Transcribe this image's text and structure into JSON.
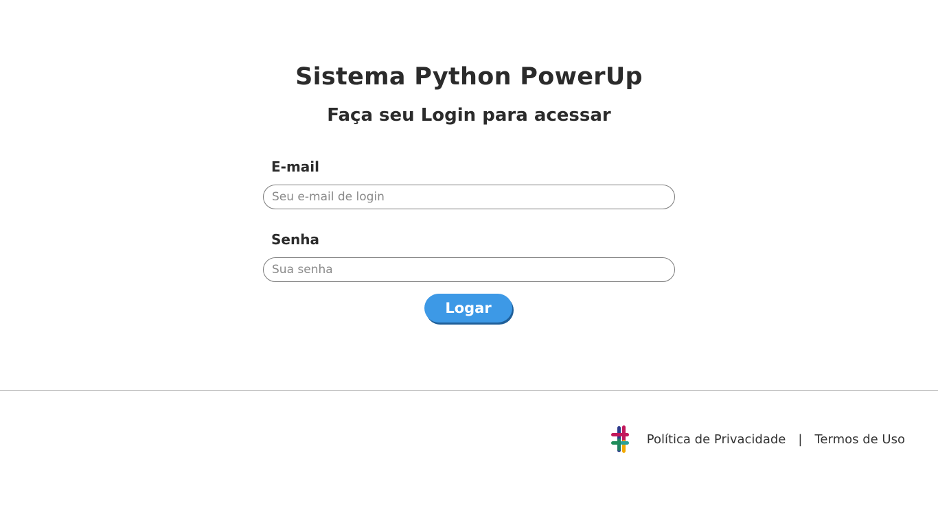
{
  "page": {
    "title": "Sistema Python PowerUp",
    "subtitle": "Faça seu Login para acessar"
  },
  "form": {
    "email_label": "E-mail",
    "email_placeholder": "Seu e-mail de login",
    "email_value": "",
    "password_label": "Senha",
    "password_placeholder": "Sua senha",
    "password_value": "",
    "submit_label": "Logar"
  },
  "footer": {
    "logo_icon": "hashtag-logo-icon",
    "privacy_link": "Política de Privacidade",
    "separator": "|",
    "terms_link": "Termos de Uso"
  },
  "colors": {
    "button": "#3d99e6",
    "button_shadow": "#1f5f99",
    "text": "#2b2b2b",
    "divider": "#a8a8a8"
  }
}
